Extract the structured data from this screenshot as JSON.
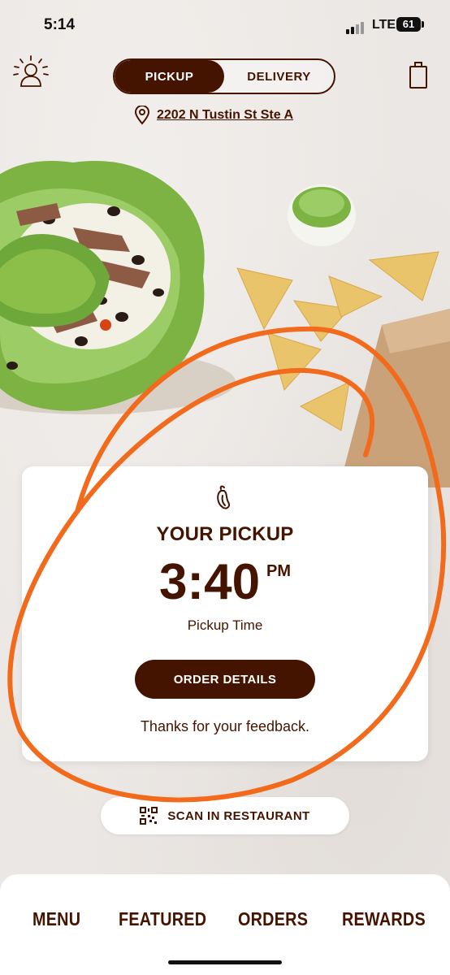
{
  "status_bar": {
    "time": "5:14",
    "network": "LTE",
    "battery": "61"
  },
  "header": {
    "account_icon": "account-sun-icon",
    "modes": [
      "PICKUP",
      "DELIVERY"
    ],
    "active_mode": "PICKUP",
    "bag_icon": "bag-icon"
  },
  "location": {
    "icon": "location-pin-icon",
    "address": "2202 N Tustin St Ste A"
  },
  "pickup_card": {
    "icon": "pepper-icon",
    "title": "YOUR PICKUP",
    "time": "3:40",
    "ampm": "PM",
    "time_label": "Pickup Time",
    "order_button": "ORDER DETAILS",
    "feedback": "Thanks for your feedback."
  },
  "scan": {
    "icon": "qr-code-icon",
    "label": "SCAN IN RESTAURANT"
  },
  "bottom_nav": {
    "items": [
      "MENU",
      "FEATURED",
      "ORDERS",
      "REWARDS"
    ]
  },
  "colors": {
    "brand": "#451400",
    "annotation": "#f26a1b",
    "background": "#ebe7e4"
  }
}
